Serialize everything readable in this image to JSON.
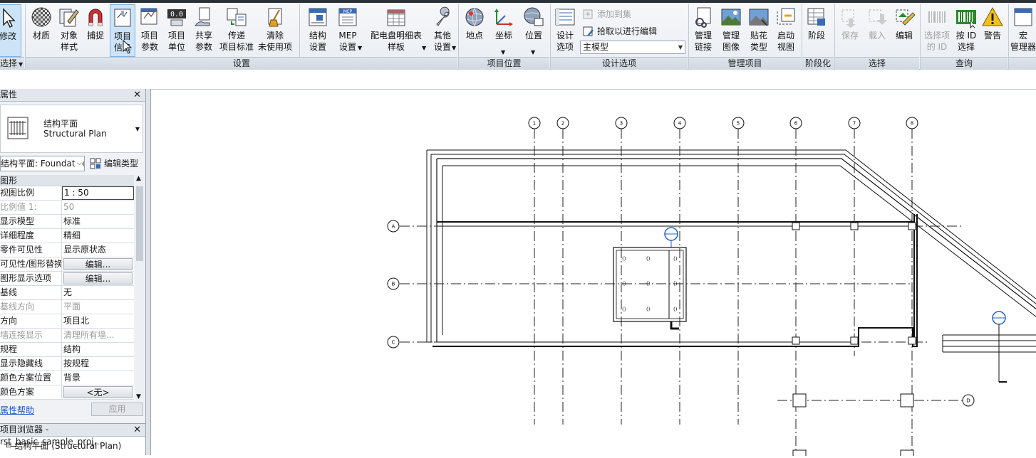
{
  "ribbon": {
    "modify_label": "修改",
    "select_label": "选择",
    "buttons": {
      "material": "材质",
      "object_style": "对象\n样式",
      "snap": "捕捉",
      "project_info": "项目\n信息",
      "project_params": "项目\n参数",
      "project_units": "项目\n单位",
      "shared_params": "共享\n参数",
      "transfer_standards": "传递\n项目标准",
      "purge": "清除\n未使用项",
      "struct_settings": "结构\n设置",
      "mep_settings": "MEP\n设置",
      "panel_schedule": "配电盘明细表\n样板",
      "other_settings": "其他\n设置",
      "location": "地点",
      "coordinates": "坐标",
      "position": "位置",
      "design_options": "设计\n选项",
      "manage_links": "管理\n链接",
      "manage_images": "管理\n图像",
      "decal_types": "贴花\n类型",
      "starting_view": "启动\n视图",
      "phases": "阶段",
      "save_sel": "保存",
      "load_sel": "载入",
      "edit_sel": "编辑",
      "select_ids": "选择项\n的 ID",
      "select_by_id": "按 ID\n选择",
      "warnings": "警告",
      "macro_manager": "宏\n管理器"
    },
    "design_option_rows": {
      "add_to_set": "添加到集",
      "pick_to_edit": "拾取以进行编辑",
      "main_model": "主模型"
    },
    "panels": {
      "settings": "设置",
      "project_location": "项目位置",
      "design_options": "设计选项",
      "manage_project": "管理项目",
      "phasing": "阶段化",
      "selection": "选择",
      "inquiry": "查询"
    }
  },
  "properties": {
    "title": "属性",
    "type_name_cn": "结构平面",
    "type_name_en": "Structural Plan",
    "view_selector": "结构平面: Foundation",
    "edit_type": "编辑类型",
    "group": "图形",
    "rows": [
      {
        "k": "视图比例",
        "v": "1 : 50",
        "style": "box"
      },
      {
        "k": "比例值 1:",
        "v": "50",
        "style": "dim"
      },
      {
        "k": "显示模型",
        "v": "标准"
      },
      {
        "k": "详细程度",
        "v": "精细"
      },
      {
        "k": "零件可见性",
        "v": "显示原状态"
      },
      {
        "k": "可见性/图形替换",
        "v": "编辑...",
        "style": "btn"
      },
      {
        "k": "图形显示选项",
        "v": "编辑...",
        "style": "btn"
      },
      {
        "k": "基线",
        "v": "无"
      },
      {
        "k": "基线方向",
        "v": "平面",
        "style": "dim"
      },
      {
        "k": "方向",
        "v": "项目北"
      },
      {
        "k": "墙连接显示",
        "v": "清理所有墙...",
        "style": "dim"
      },
      {
        "k": "规程",
        "v": "结构"
      },
      {
        "k": "显示隐藏线",
        "v": "按规程"
      },
      {
        "k": "颜色方案位置",
        "v": "背景"
      },
      {
        "k": "颜色方案",
        "v": "<无>",
        "style": "btn"
      }
    ],
    "help_link": "属性帮助",
    "apply_button": "应用"
  },
  "project_browser": {
    "title": "项目浏览器 - rst_basic_sample_proj...",
    "node_label": "结构平面 (Structural Plan)"
  },
  "canvas": {
    "grid_bubbles_top": [
      "1",
      "2",
      "3",
      "4",
      "5",
      "6",
      "7",
      "8"
    ],
    "grid_bubbles_left": [
      "A",
      "B",
      "C"
    ],
    "grid_bubble_right": "D"
  },
  "colors": {
    "accent": "#1f5fbf",
    "ribbon_bg": "#eef1f5",
    "panel_bar": "#d6dde5"
  }
}
